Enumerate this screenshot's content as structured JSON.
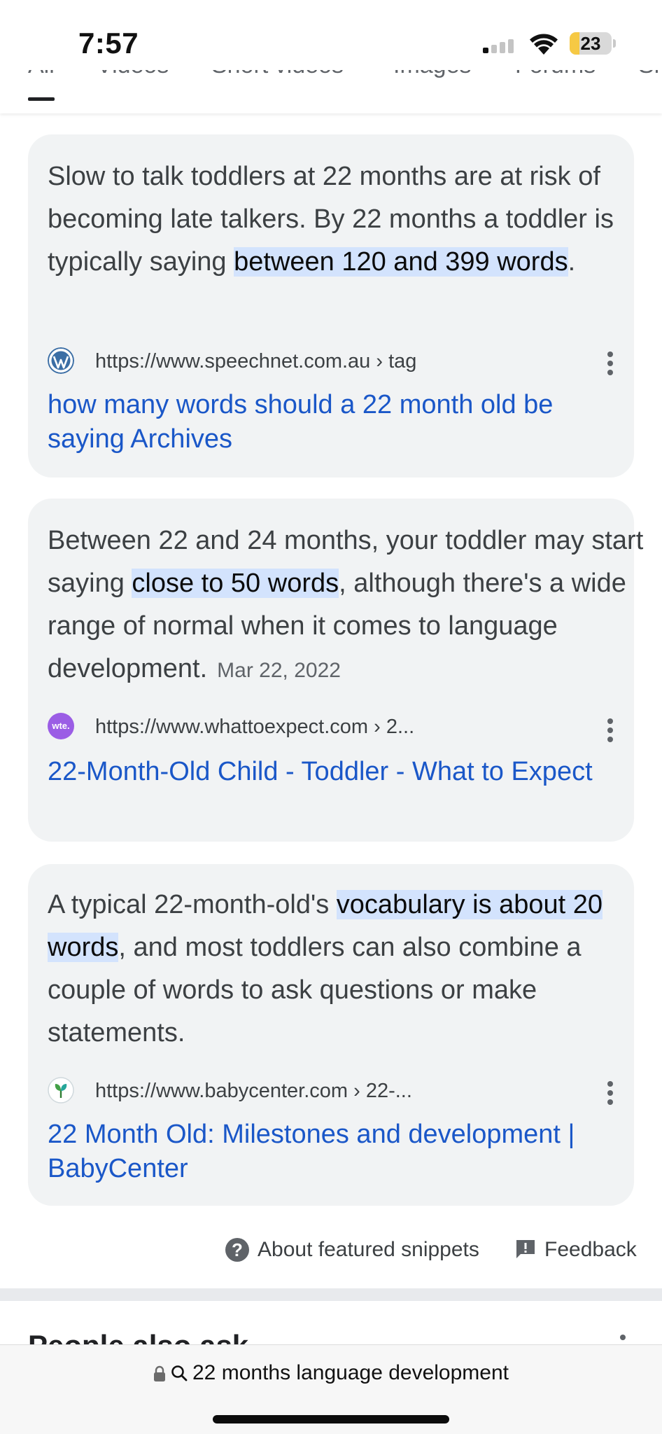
{
  "status_bar": {
    "time": "7:57",
    "battery_level": "23",
    "battery_fraction": 0.23
  },
  "tabs": [
    {
      "label": "All",
      "active": true
    },
    {
      "label": "Videos",
      "active": false
    },
    {
      "label": "Short videos",
      "active": false
    },
    {
      "label": "Images",
      "active": false
    },
    {
      "label": "Forums",
      "active": false
    },
    {
      "label": "Sh",
      "active": false
    }
  ],
  "results": [
    {
      "snippet_before": "Slow to talk toddlers at 22 months are at risk of becoming late talkers. By 22 months a toddler is typically saying ",
      "snippet_highlight": "between 120 and 399 words",
      "snippet_after": ".",
      "date": "",
      "url": "https://www.speechnet.com.au",
      "breadcrumb": " › tag",
      "favicon": "wordpress-icon",
      "title": "how many words should a 22 month old be saying Archives"
    },
    {
      "snippet_before": "Between 22 and 24 months, your toddler may start saying ",
      "snippet_highlight": "close to 50 words",
      "snippet_after": ", although there's a wide range of normal when it comes to language development.",
      "date": "Mar 22, 2022",
      "url": "https://www.whattoexpect.com",
      "breadcrumb": " › 2...",
      "favicon": "wte-icon",
      "favicon_text": "wte.",
      "title": "22-Month-Old Child - Toddler - What to Expect"
    },
    {
      "snippet_before": "A typical 22-month-old's ",
      "snippet_highlight": "vocabulary is about 20 words",
      "snippet_after": ", and most toddlers can also combine a couple of words to ask questions or make statements.",
      "date": "",
      "url": "https://www.babycenter.com",
      "breadcrumb": " › 22-...",
      "favicon": "babycenter-icon",
      "title": "22 Month Old: Milestones and development | BabyCenter"
    }
  ],
  "footer": {
    "about_label": "About featured snippets",
    "feedback_label": "Feedback"
  },
  "next_section": {
    "heading": "People also ask"
  },
  "address_bar": {
    "query": "22 months language development"
  },
  "colors": {
    "link": "#1a57c8",
    "highlight": "#d3e3fd",
    "card_bg": "#f1f3f4"
  }
}
